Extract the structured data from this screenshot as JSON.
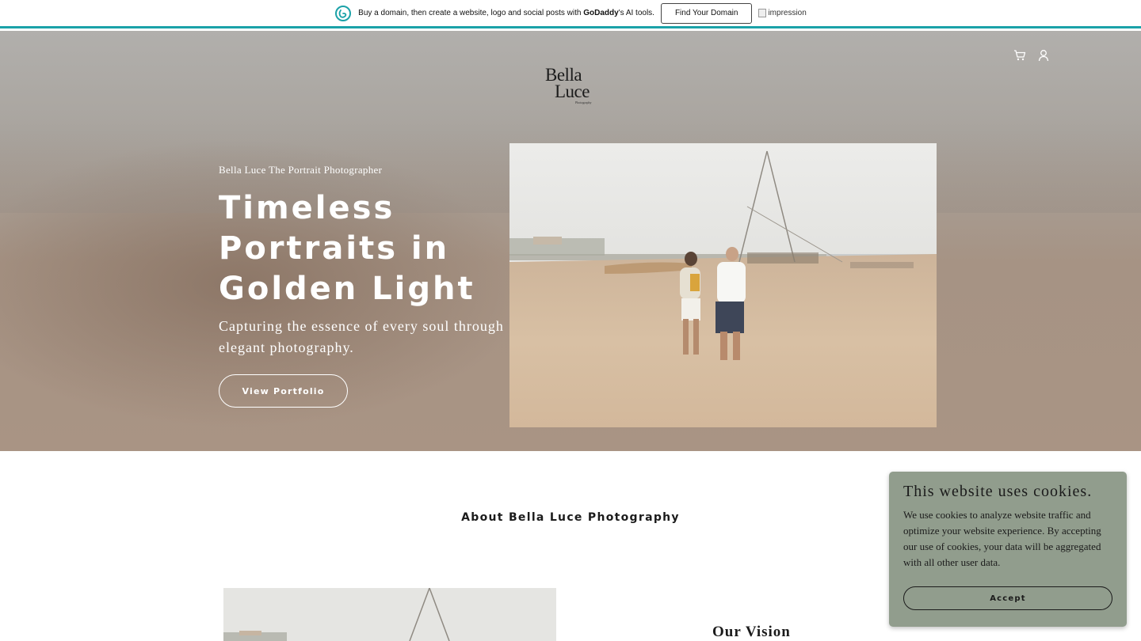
{
  "promo": {
    "text_before": "Buy a domain, then create a website, logo and social posts with ",
    "brand": "GoDaddy",
    "text_after": "'s AI tools.",
    "button_label": "Find Your Domain",
    "image_alt": "impression",
    "accent_color": "#1ba2a8"
  },
  "header": {
    "logo_line1": "Bella",
    "logo_line2": "Luce",
    "logo_tagline": "Photography",
    "icons": [
      "cart-icon",
      "account-icon"
    ]
  },
  "hero": {
    "eyebrow": "Bella Luce The Portrait Photographer",
    "title": "Timeless Portraits in Golden Light",
    "subtitle": "Capturing the essence of every soul through elegant photography.",
    "cta_label": "View Portfolio"
  },
  "about": {
    "heading": "About Bella Luce Photography",
    "vision_heading": "Our Vision"
  },
  "cookie_banner": {
    "title": "This website uses cookies.",
    "body": "We use cookies to analyze website traffic and optimize your website experience. By accepting our use of cookies, your data will be aggregated with all other user data.",
    "accept_label": "Accept",
    "background_color": "#919d8d"
  }
}
